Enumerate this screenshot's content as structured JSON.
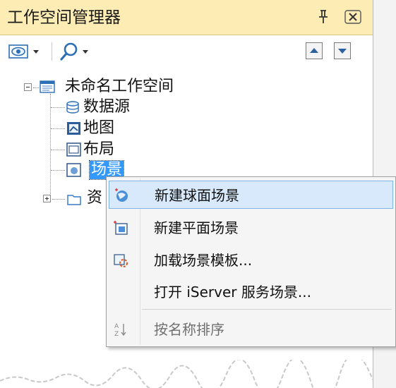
{
  "panel": {
    "title": "工作空间管理器"
  },
  "tree": {
    "root": "未命名工作空间",
    "items": [
      {
        "label": "数据源",
        "icon": "datasource-icon"
      },
      {
        "label": "地图",
        "icon": "map-icon"
      },
      {
        "label": "布局",
        "icon": "layout-icon"
      },
      {
        "label": "场景",
        "icon": "scene-icon",
        "selected": true
      },
      {
        "label": "资",
        "icon": "folder-icon",
        "collapsed": true
      }
    ]
  },
  "context_menu": {
    "items": [
      {
        "label": "新建球面场景",
        "icon": "globe-scene-icon",
        "highlighted": true
      },
      {
        "label": "新建平面场景",
        "icon": "plane-scene-icon"
      },
      {
        "label": "加载场景模板...",
        "icon": "load-template-icon"
      },
      {
        "label": "打开 iServer 服务场景..."
      },
      {
        "label": "按名称排序",
        "icon": "sort-az-icon",
        "disabled": true
      }
    ]
  },
  "colors": {
    "title_bg": "#fdedb4",
    "selection": "#3399ff",
    "menu_highlight": "#d7e9fb"
  }
}
